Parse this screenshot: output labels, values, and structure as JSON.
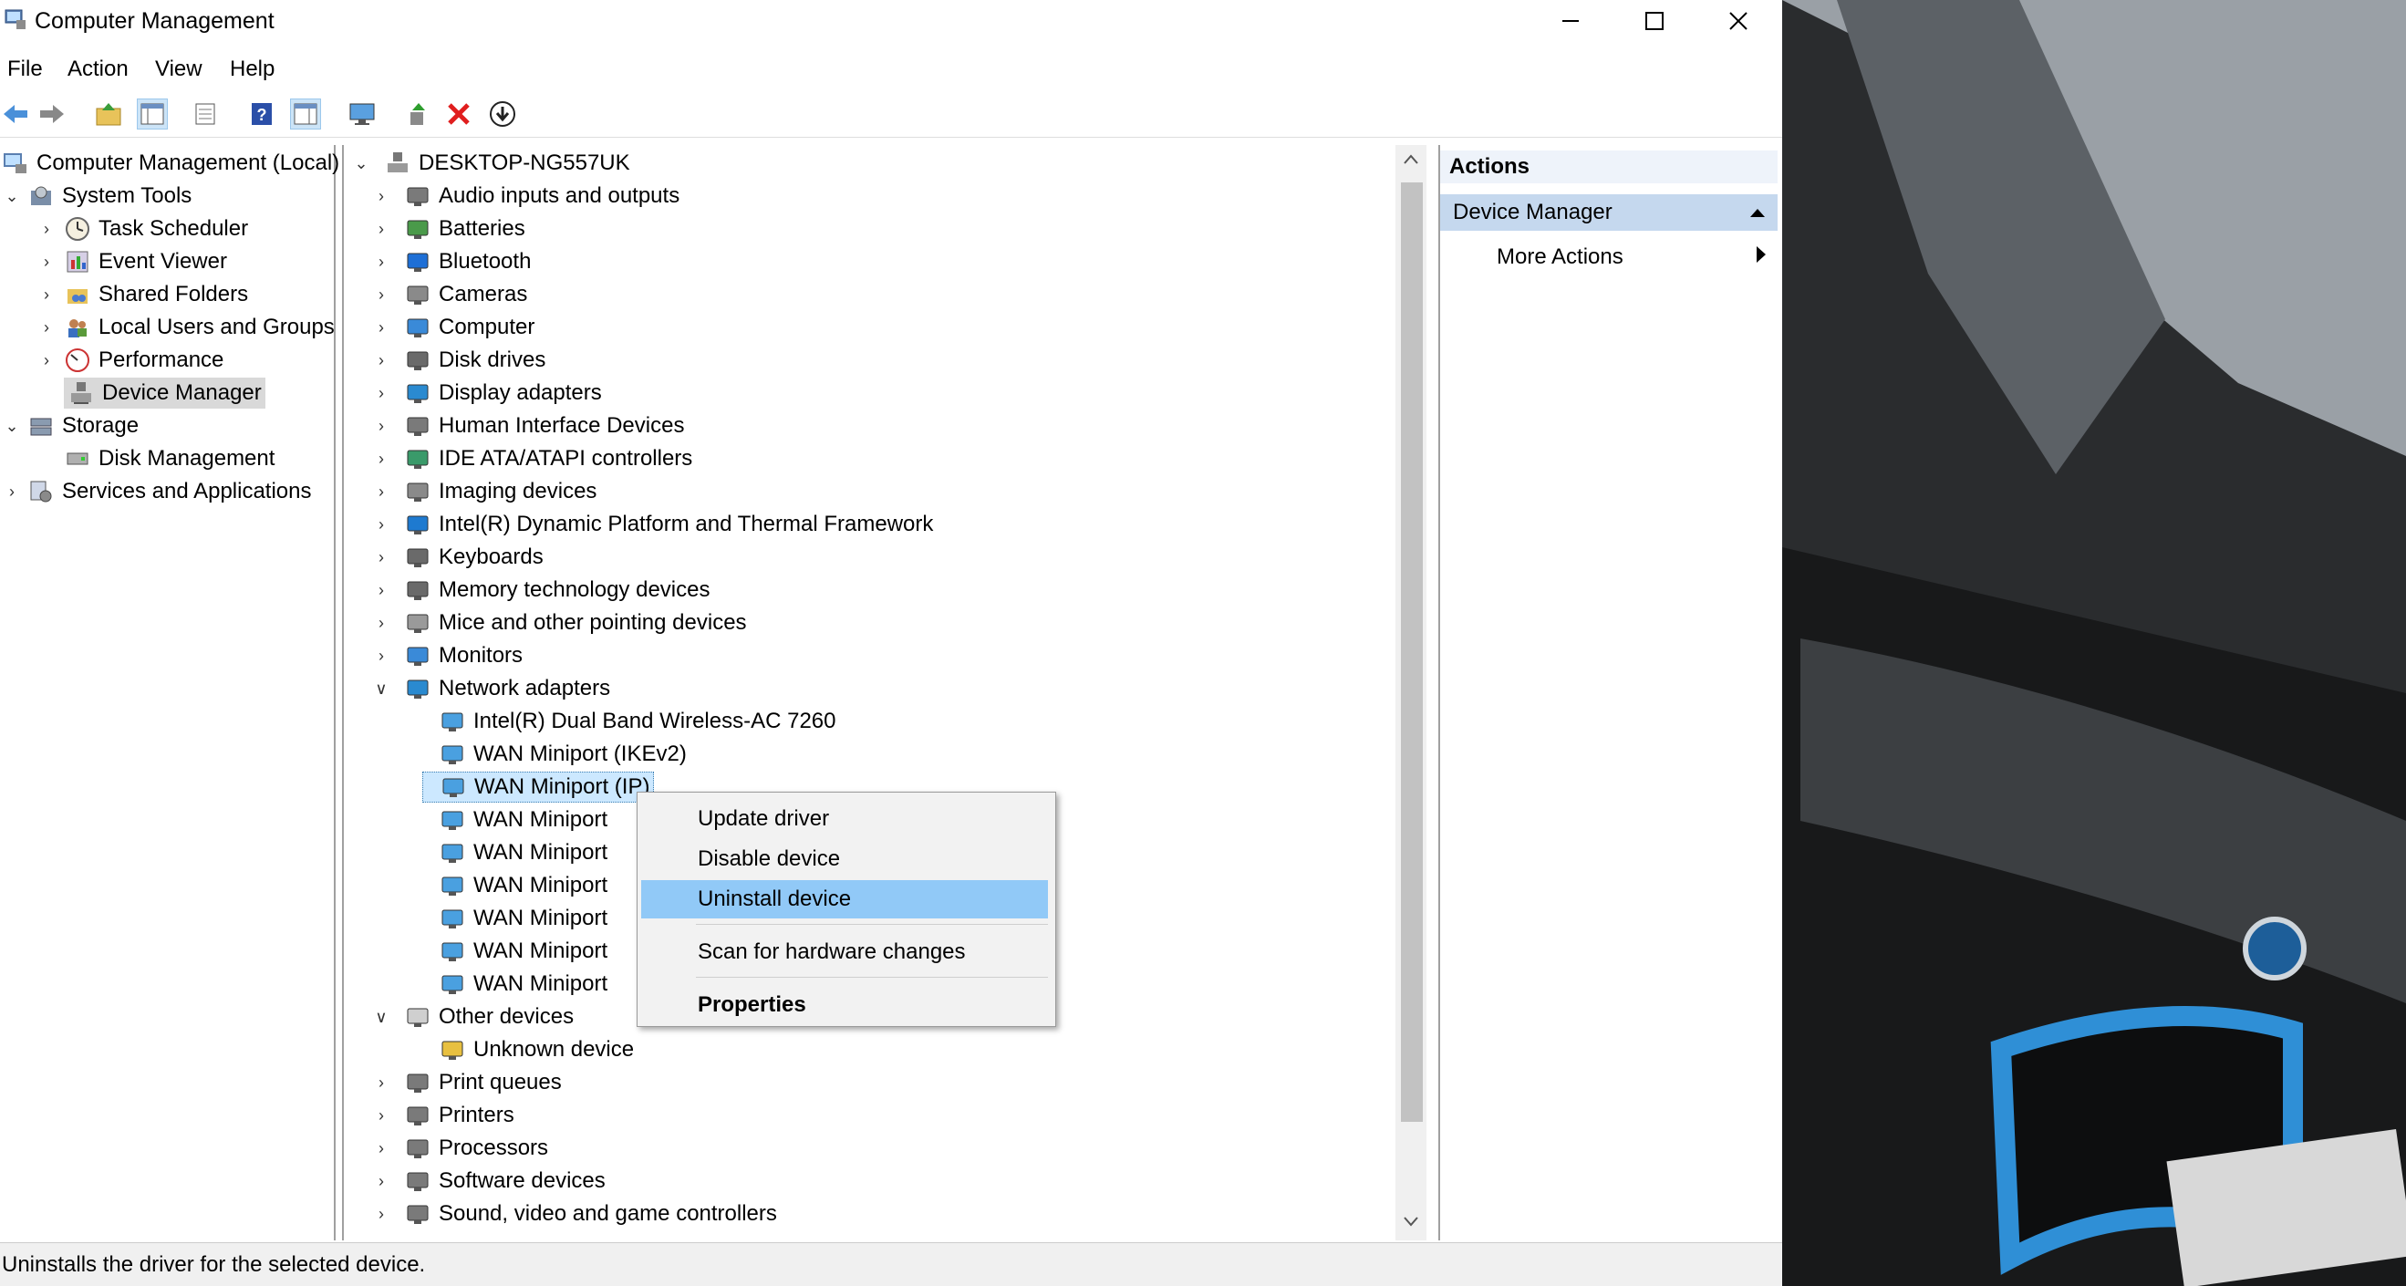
{
  "window": {
    "title": "Computer Management"
  },
  "menu": [
    "File",
    "Action",
    "View",
    "Help"
  ],
  "toolbar_icons": [
    "back-arrow-icon",
    "forward-arrow-icon",
    "up-folder-icon",
    "show-hide-tree-icon",
    "properties-icon",
    "help-icon",
    "show-hide-action-pane-icon",
    "monitor-icon",
    "enable-device-icon",
    "uninstall-x-icon",
    "download-update-icon"
  ],
  "left_tree": [
    {
      "label": "Computer Management (Local)"
    },
    {
      "label": "System Tools"
    },
    {
      "label": "Task Scheduler"
    },
    {
      "label": "Event Viewer"
    },
    {
      "label": "Shared Folders"
    },
    {
      "label": "Local Users and Groups"
    },
    {
      "label": "Performance"
    },
    {
      "label": "Device Manager"
    },
    {
      "label": "Storage"
    },
    {
      "label": "Disk Management"
    },
    {
      "label": "Services and Applications"
    }
  ],
  "device_tree": {
    "root": "DESKTOP-NG557UK",
    "categories": [
      "Audio inputs and outputs",
      "Batteries",
      "Bluetooth",
      "Cameras",
      "Computer",
      "Disk drives",
      "Display adapters",
      "Human Interface Devices",
      "IDE ATA/ATAPI controllers",
      "Imaging devices",
      "Intel(R) Dynamic Platform and Thermal Framework",
      "Keyboards",
      "Memory technology devices",
      "Mice and other pointing devices",
      "Monitors",
      "Network adapters"
    ],
    "network_children": [
      "Intel(R) Dual Band Wireless-AC 7260",
      "WAN Miniport (IKEv2)",
      "WAN Miniport (IP)",
      "WAN Miniport",
      "WAN Miniport",
      "WAN Miniport",
      "WAN Miniport",
      "WAN Miniport",
      "WAN Miniport"
    ],
    "other_devices": "Other devices",
    "other_children": [
      "Unknown device"
    ],
    "tail_categories": [
      "Print queues",
      "Printers",
      "Processors",
      "Software devices",
      "Sound, video and game controllers"
    ]
  },
  "actions": {
    "header": "Actions",
    "section": "Device Manager",
    "more": "More Actions"
  },
  "context_menu": {
    "update": "Update driver",
    "disable": "Disable device",
    "uninstall": "Uninstall device",
    "scan": "Scan for hardware changes",
    "properties": "Properties"
  },
  "status": "Uninstalls the driver for the selected device.",
  "colors": {
    "accent": "#91c9f7",
    "selection": "#cce8ff",
    "actions_section": "#c5d8ee"
  }
}
